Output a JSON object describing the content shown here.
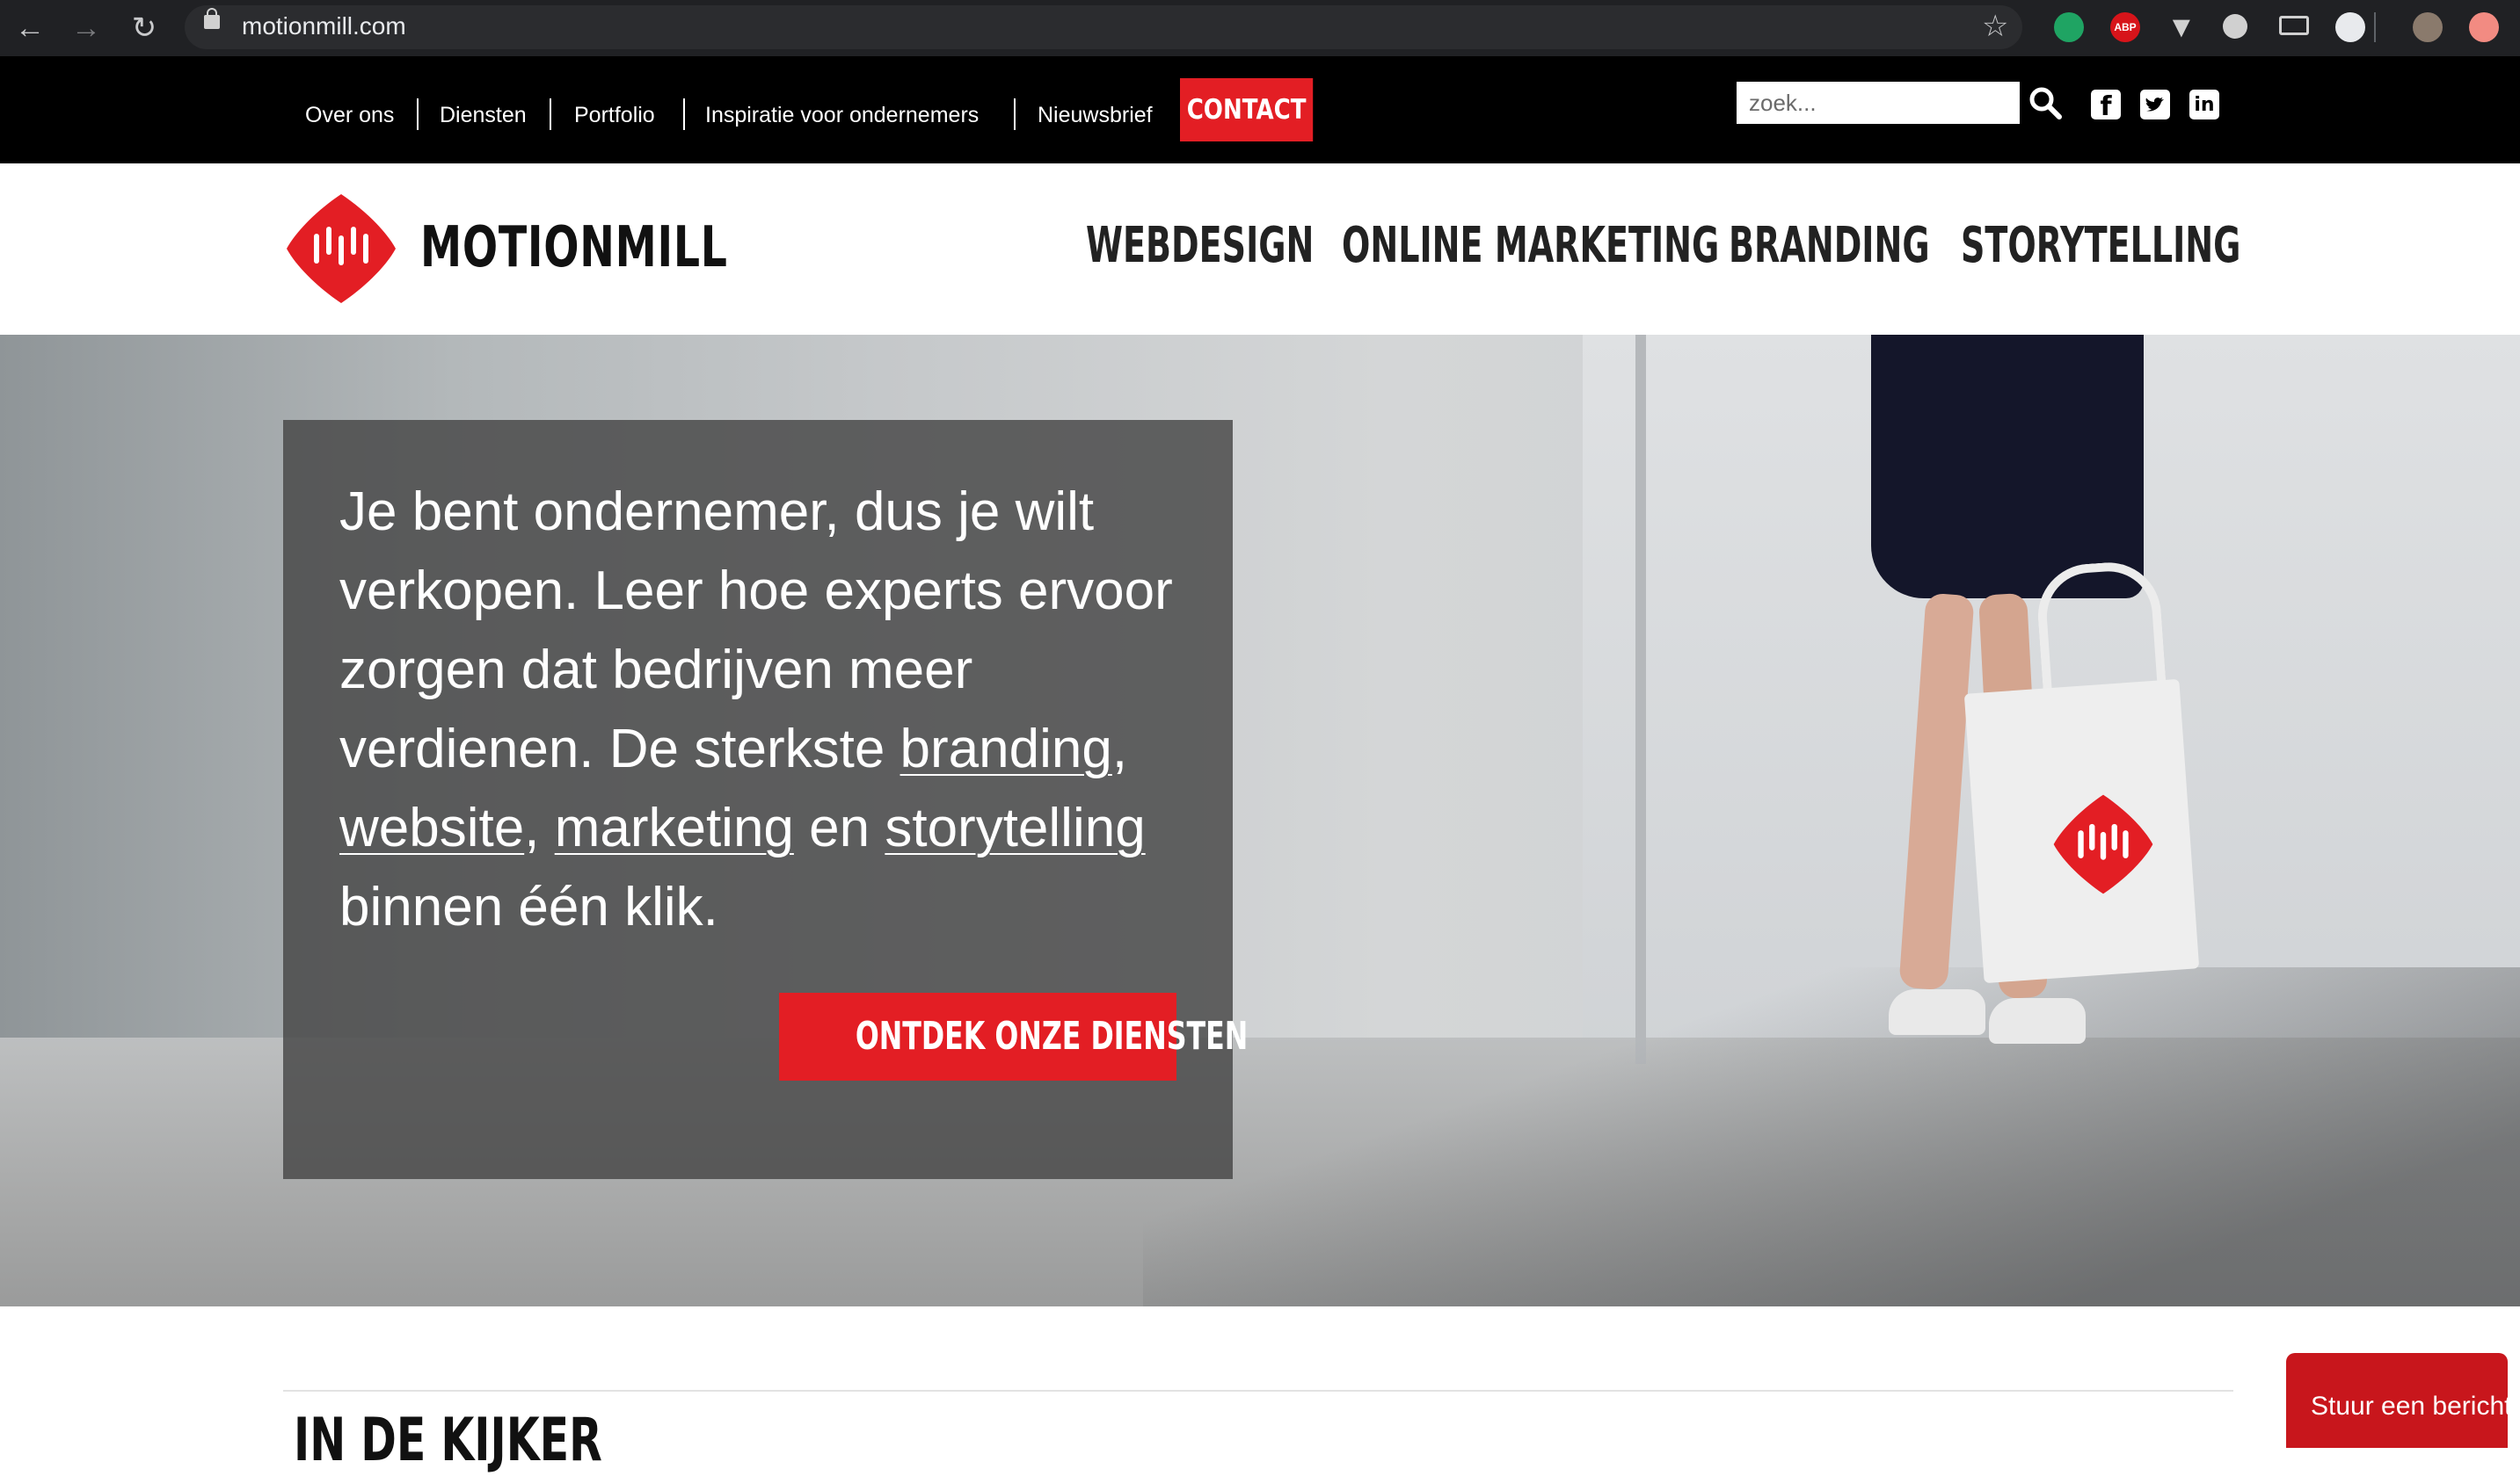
{
  "browser": {
    "url": "motionmill.com",
    "extensions": [
      "evernote-icon",
      "adblock-plus-icon",
      "vivaldi-icon",
      "lightbulb-icon",
      "cast-icon",
      "translate-icon",
      "profile-avatar",
      "upload-icon"
    ],
    "abp_label": "ABP"
  },
  "topbar": {
    "links": [
      "Over ons",
      "Diensten",
      "Portfolio",
      "Inspiratie voor ondernemers",
      "Nieuwsbrief"
    ],
    "contact_label": "CONTACT",
    "search_placeholder": "zoek...",
    "social": [
      "facebook-icon",
      "twitter-icon",
      "linkedin-icon"
    ]
  },
  "header": {
    "brand": "MOTIONMILL",
    "nav": [
      "WEBDESIGN",
      "ONLINE MARKETING",
      "BRANDING",
      "STORYTELLING"
    ]
  },
  "hero": {
    "text_intro": "Je bent ondernemer, dus je wilt verkopen. Leer hoe experts ervoor zorgen dat bedrijven meer verdienen. De sterkste",
    "link_branding": "branding",
    "comma1": ",",
    "link_website": "website",
    "comma2": ",",
    "link_marketing": "marketing",
    "and": "en",
    "link_storytelling": "storytelling",
    "text_end": "binnen één klik.",
    "cta_label": "ONTDEK ONZE DIENSTEN"
  },
  "section": {
    "title": "IN DE KIJKER"
  },
  "chat": {
    "label": "Stuur een bericht"
  },
  "colors": {
    "accent": "#e31e24",
    "topbar": "#000000",
    "chrome": "#202124"
  }
}
